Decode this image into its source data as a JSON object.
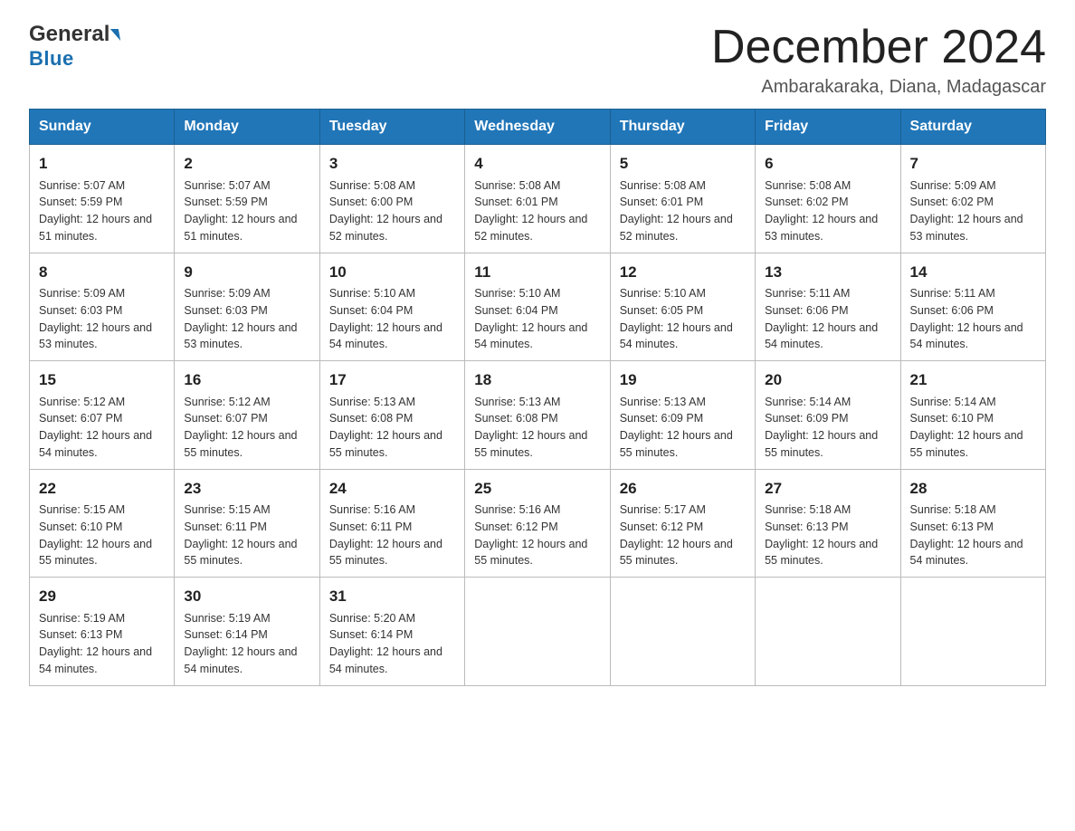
{
  "header": {
    "logo_general": "General",
    "logo_blue": "Blue",
    "month_title": "December 2024",
    "location": "Ambarakaraka, Diana, Madagascar"
  },
  "days_of_week": [
    "Sunday",
    "Monday",
    "Tuesday",
    "Wednesday",
    "Thursday",
    "Friday",
    "Saturday"
  ],
  "weeks": [
    [
      {
        "day": 1,
        "sunrise": "5:07 AM",
        "sunset": "5:59 PM",
        "daylight": "12 hours and 51 minutes."
      },
      {
        "day": 2,
        "sunrise": "5:07 AM",
        "sunset": "5:59 PM",
        "daylight": "12 hours and 51 minutes."
      },
      {
        "day": 3,
        "sunrise": "5:08 AM",
        "sunset": "6:00 PM",
        "daylight": "12 hours and 52 minutes."
      },
      {
        "day": 4,
        "sunrise": "5:08 AM",
        "sunset": "6:01 PM",
        "daylight": "12 hours and 52 minutes."
      },
      {
        "day": 5,
        "sunrise": "5:08 AM",
        "sunset": "6:01 PM",
        "daylight": "12 hours and 52 minutes."
      },
      {
        "day": 6,
        "sunrise": "5:08 AM",
        "sunset": "6:02 PM",
        "daylight": "12 hours and 53 minutes."
      },
      {
        "day": 7,
        "sunrise": "5:09 AM",
        "sunset": "6:02 PM",
        "daylight": "12 hours and 53 minutes."
      }
    ],
    [
      {
        "day": 8,
        "sunrise": "5:09 AM",
        "sunset": "6:03 PM",
        "daylight": "12 hours and 53 minutes."
      },
      {
        "day": 9,
        "sunrise": "5:09 AM",
        "sunset": "6:03 PM",
        "daylight": "12 hours and 53 minutes."
      },
      {
        "day": 10,
        "sunrise": "5:10 AM",
        "sunset": "6:04 PM",
        "daylight": "12 hours and 54 minutes."
      },
      {
        "day": 11,
        "sunrise": "5:10 AM",
        "sunset": "6:04 PM",
        "daylight": "12 hours and 54 minutes."
      },
      {
        "day": 12,
        "sunrise": "5:10 AM",
        "sunset": "6:05 PM",
        "daylight": "12 hours and 54 minutes."
      },
      {
        "day": 13,
        "sunrise": "5:11 AM",
        "sunset": "6:06 PM",
        "daylight": "12 hours and 54 minutes."
      },
      {
        "day": 14,
        "sunrise": "5:11 AM",
        "sunset": "6:06 PM",
        "daylight": "12 hours and 54 minutes."
      }
    ],
    [
      {
        "day": 15,
        "sunrise": "5:12 AM",
        "sunset": "6:07 PM",
        "daylight": "12 hours and 54 minutes."
      },
      {
        "day": 16,
        "sunrise": "5:12 AM",
        "sunset": "6:07 PM",
        "daylight": "12 hours and 55 minutes."
      },
      {
        "day": 17,
        "sunrise": "5:13 AM",
        "sunset": "6:08 PM",
        "daylight": "12 hours and 55 minutes."
      },
      {
        "day": 18,
        "sunrise": "5:13 AM",
        "sunset": "6:08 PM",
        "daylight": "12 hours and 55 minutes."
      },
      {
        "day": 19,
        "sunrise": "5:13 AM",
        "sunset": "6:09 PM",
        "daylight": "12 hours and 55 minutes."
      },
      {
        "day": 20,
        "sunrise": "5:14 AM",
        "sunset": "6:09 PM",
        "daylight": "12 hours and 55 minutes."
      },
      {
        "day": 21,
        "sunrise": "5:14 AM",
        "sunset": "6:10 PM",
        "daylight": "12 hours and 55 minutes."
      }
    ],
    [
      {
        "day": 22,
        "sunrise": "5:15 AM",
        "sunset": "6:10 PM",
        "daylight": "12 hours and 55 minutes."
      },
      {
        "day": 23,
        "sunrise": "5:15 AM",
        "sunset": "6:11 PM",
        "daylight": "12 hours and 55 minutes."
      },
      {
        "day": 24,
        "sunrise": "5:16 AM",
        "sunset": "6:11 PM",
        "daylight": "12 hours and 55 minutes."
      },
      {
        "day": 25,
        "sunrise": "5:16 AM",
        "sunset": "6:12 PM",
        "daylight": "12 hours and 55 minutes."
      },
      {
        "day": 26,
        "sunrise": "5:17 AM",
        "sunset": "6:12 PM",
        "daylight": "12 hours and 55 minutes."
      },
      {
        "day": 27,
        "sunrise": "5:18 AM",
        "sunset": "6:13 PM",
        "daylight": "12 hours and 55 minutes."
      },
      {
        "day": 28,
        "sunrise": "5:18 AM",
        "sunset": "6:13 PM",
        "daylight": "12 hours and 54 minutes."
      }
    ],
    [
      {
        "day": 29,
        "sunrise": "5:19 AM",
        "sunset": "6:13 PM",
        "daylight": "12 hours and 54 minutes."
      },
      {
        "day": 30,
        "sunrise": "5:19 AM",
        "sunset": "6:14 PM",
        "daylight": "12 hours and 54 minutes."
      },
      {
        "day": 31,
        "sunrise": "5:20 AM",
        "sunset": "6:14 PM",
        "daylight": "12 hours and 54 minutes."
      },
      null,
      null,
      null,
      null
    ]
  ]
}
